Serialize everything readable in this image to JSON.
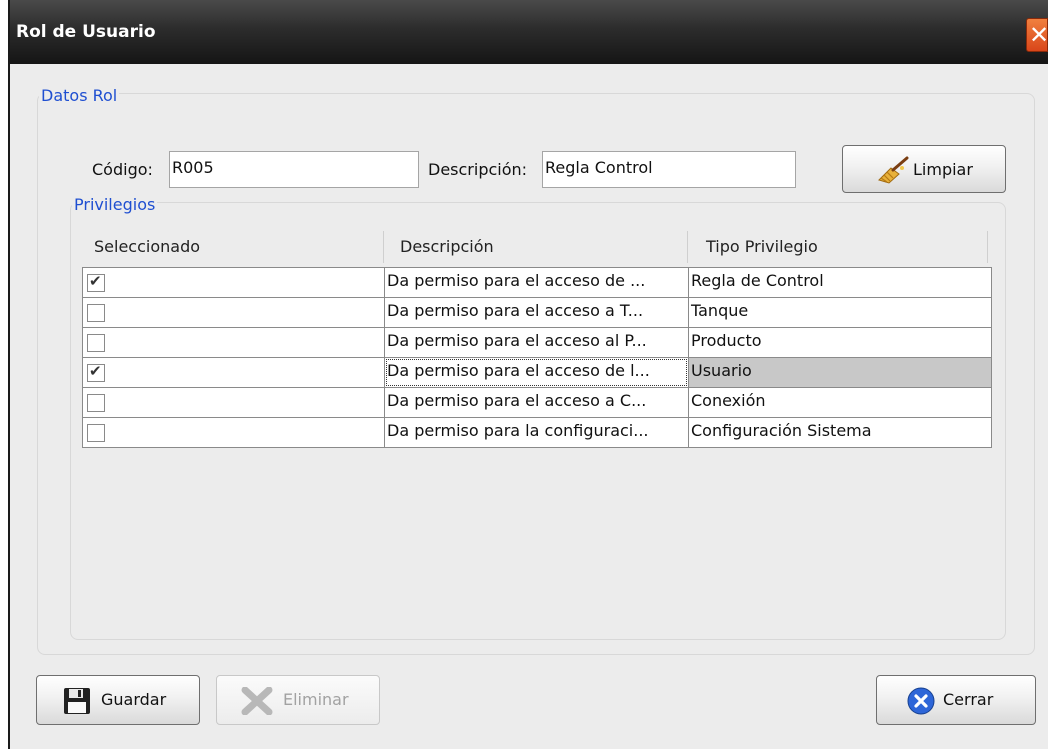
{
  "window": {
    "title": "Rol de Usuario"
  },
  "datos_rol": {
    "legend": "Datos Rol",
    "codigo_label": "Código:",
    "codigo_value": "R005",
    "descripcion_label": "Descripción:",
    "descripcion_value": "Regla Control",
    "limpiar_label": "Limpiar"
  },
  "privilegios": {
    "legend": "Privilegios",
    "columns": [
      "Seleccionado",
      "Descripción",
      "Tipo Privilegio"
    ],
    "rows": [
      {
        "selected": true,
        "descripcion": "Da permiso para el acceso de ...",
        "tipo": "Regla de Control"
      },
      {
        "selected": false,
        "descripcion": "Da permiso para el acceso a T...",
        "tipo": "Tanque"
      },
      {
        "selected": false,
        "descripcion": "Da permiso para el acceso al P...",
        "tipo": "Producto"
      },
      {
        "selected": true,
        "descripcion": "Da permiso para el acceso de l...",
        "tipo": "Usuario"
      },
      {
        "selected": false,
        "descripcion": "Da permiso para el acceso a C...",
        "tipo": "Conexión"
      },
      {
        "selected": false,
        "descripcion": "Da permiso para la configuraci...",
        "tipo": "Configuración Sistema"
      }
    ],
    "highlighted_row": 3
  },
  "footer": {
    "guardar_label": "Guardar",
    "eliminar_label": "Eliminar",
    "cerrar_label": "Cerrar"
  },
  "colors": {
    "legend": "#1f4fd1",
    "close_button": "#e0531f",
    "row_highlight": "#c8c8c8"
  },
  "icons": {
    "limpiar": "broom-icon",
    "guardar": "floppy-disk-icon",
    "eliminar": "x-delete-icon",
    "cerrar": "close-circle-icon",
    "window_close": "close-icon"
  }
}
